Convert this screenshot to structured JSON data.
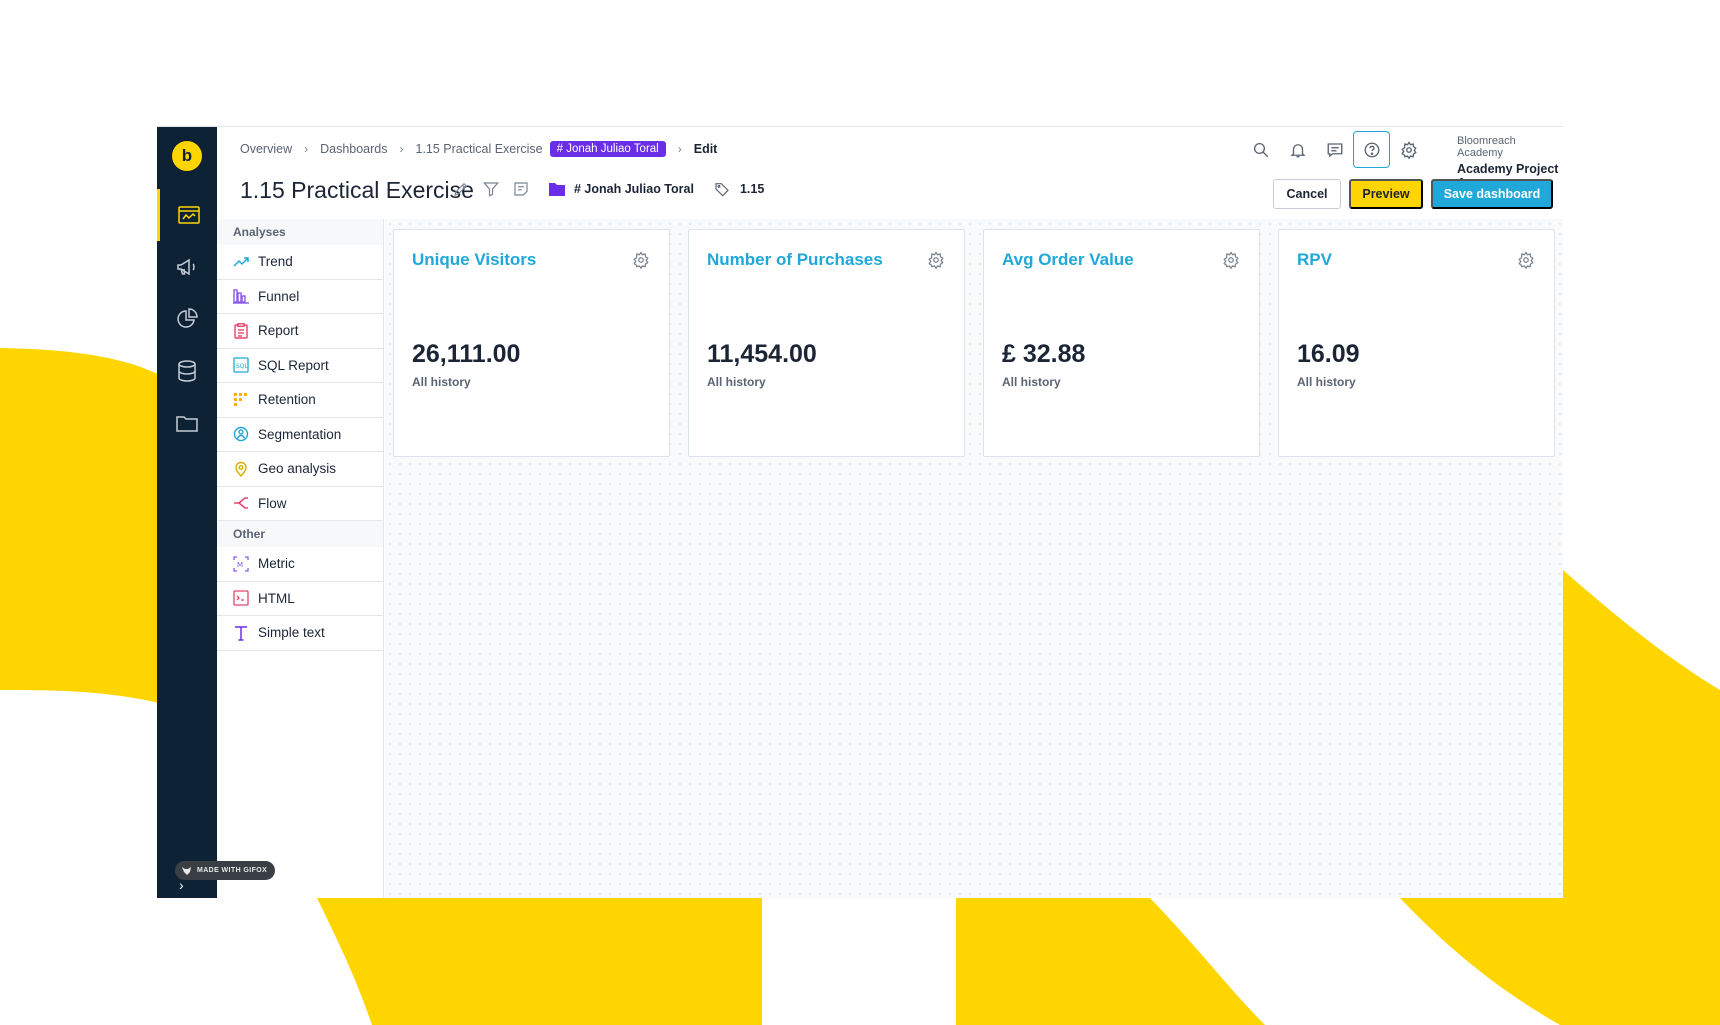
{
  "colors": {
    "brand_yellow": "#ffd500",
    "rail_dark": "#0e2235",
    "accent_blue": "#1fa8d9",
    "tag_purple": "#6a2ee8"
  },
  "rail": {
    "logo_letter": "b",
    "items": [
      {
        "icon": "dashboard-icon",
        "active": true
      },
      {
        "icon": "megaphone-icon",
        "active": false
      },
      {
        "icon": "pie-chart-icon",
        "active": false
      },
      {
        "icon": "database-icon",
        "active": false
      },
      {
        "icon": "folder-icon",
        "active": false
      }
    ],
    "gifox_badge": "MADE WITH GIFOX"
  },
  "breadcrumb": {
    "items": [
      "Overview",
      "Dashboards",
      "1.15 Practical Exercise"
    ],
    "tag": "# Jonah Juliao Toral",
    "current": "Edit"
  },
  "header_icons": [
    "search-icon",
    "bell-icon",
    "chat-icon",
    "help-icon",
    "gear-icon"
  ],
  "account": {
    "org": "Bloomreach Academy",
    "project": "Academy Project A"
  },
  "title": {
    "text": "1.15 Practical Exercise",
    "folder": "# Jonah Juliao Toral",
    "tag": "1.15"
  },
  "actions": {
    "cancel": "Cancel",
    "preview": "Preview",
    "save": "Save dashboard"
  },
  "panel": {
    "analyses_label": "Analyses",
    "analyses": [
      {
        "label": "Trend",
        "icon": "trend-icon"
      },
      {
        "label": "Funnel",
        "icon": "funnel-icon"
      },
      {
        "label": "Report",
        "icon": "report-icon"
      },
      {
        "label": "SQL Report",
        "icon": "sql-icon"
      },
      {
        "label": "Retention",
        "icon": "retention-icon"
      },
      {
        "label": "Segmentation",
        "icon": "segmentation-icon"
      },
      {
        "label": "Geo analysis",
        "icon": "geo-pin-icon"
      },
      {
        "label": "Flow",
        "icon": "flow-icon"
      }
    ],
    "other_label": "Other",
    "other": [
      {
        "label": "Metric",
        "icon": "metric-icon"
      },
      {
        "label": "HTML",
        "icon": "html-icon"
      },
      {
        "label": "Simple text",
        "icon": "text-icon"
      }
    ]
  },
  "cards": [
    {
      "title": "Unique Visitors",
      "value": "26,111.00",
      "subtitle": "All history"
    },
    {
      "title": "Number of Purchases",
      "value": "11,454.00",
      "subtitle": "All history"
    },
    {
      "title": "Avg Order Value",
      "value": "£ 32.88",
      "subtitle": "All history"
    },
    {
      "title": "RPV",
      "value": "16.09",
      "subtitle": "All history"
    }
  ]
}
